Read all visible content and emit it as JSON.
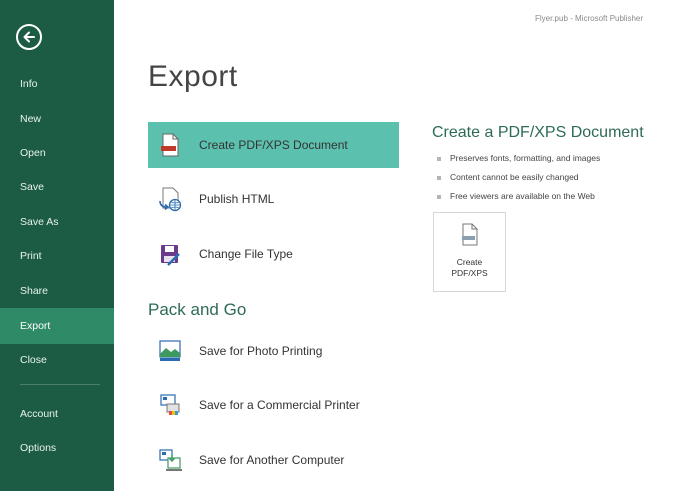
{
  "window": {
    "title": "Flyer.pub - Microsoft Publisher"
  },
  "sidebar": {
    "back_icon": "back-arrow-icon",
    "items": [
      {
        "label": "Info"
      },
      {
        "label": "New"
      },
      {
        "label": "Open"
      },
      {
        "label": "Save"
      },
      {
        "label": "Save As"
      },
      {
        "label": "Print"
      },
      {
        "label": "Share"
      },
      {
        "label": "Export",
        "active": true
      },
      {
        "label": "Close"
      },
      {
        "label": "Account"
      },
      {
        "label": "Options"
      }
    ],
    "colors": {
      "background": "#1c5c45",
      "active": "#2f8b67"
    }
  },
  "main": {
    "title": "Export",
    "options": [
      {
        "label": "Create PDF/XPS Document",
        "icon": "pdf-document-icon",
        "selected": true
      },
      {
        "label": "Publish HTML",
        "icon": "publish-html-icon"
      },
      {
        "label": "Change File Type",
        "icon": "change-file-type-icon"
      }
    ],
    "pack_section_title": "Pack and Go",
    "pack_options": [
      {
        "label": "Save for Photo Printing",
        "icon": "photo-printing-icon"
      },
      {
        "label": "Save for a Commercial Printer",
        "icon": "commercial-printer-icon"
      },
      {
        "label": "Save for Another Computer",
        "icon": "another-computer-icon"
      }
    ],
    "selected_color": "#5cc0ae"
  },
  "detail": {
    "heading": "Create a PDF/XPS Document",
    "bullets": [
      "Preserves fonts, formatting, and images",
      "Content cannot be easily changed",
      "Free viewers are available on the Web"
    ],
    "button": {
      "line1": "Create",
      "line2": "PDF/XPS",
      "icon": "pdf-document-icon"
    }
  }
}
